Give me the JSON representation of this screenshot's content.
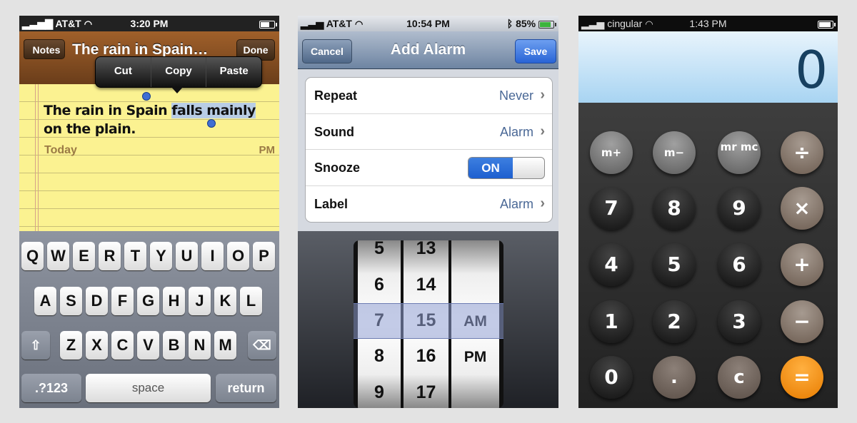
{
  "notes": {
    "status": {
      "carrier": "AT&T",
      "time": "3:20 PM"
    },
    "back_label": "Notes",
    "title": "The rain in Spain…",
    "done_label": "Done",
    "today_label": "Today",
    "time_fragment": "PM",
    "edit_menu": [
      "Cut",
      "Copy",
      "Paste"
    ],
    "text_before": "The rain in Spain ",
    "text_selected": "falls mainly",
    "text_after": " on the plain.",
    "keyboard": {
      "row1": [
        "Q",
        "W",
        "E",
        "R",
        "T",
        "Y",
        "U",
        "I",
        "O",
        "P"
      ],
      "row2": [
        "A",
        "S",
        "D",
        "F",
        "G",
        "H",
        "J",
        "K",
        "L"
      ],
      "row3": [
        "Z",
        "X",
        "C",
        "V",
        "B",
        "N",
        "M"
      ],
      "shift_glyph": "⇧",
      "delete_glyph": "⌫",
      "numbers_label": ".?123",
      "space_label": "space",
      "return_label": "return"
    }
  },
  "alarm": {
    "status": {
      "carrier": "AT&T",
      "time": "10:54 PM",
      "battery": "85%",
      "battery_level": 0.85
    },
    "cancel_label": "Cancel",
    "title": "Add Alarm",
    "save_label": "Save",
    "rows": [
      {
        "label": "Repeat",
        "value": "Never"
      },
      {
        "label": "Sound",
        "value": "Alarm"
      },
      {
        "label": "Snooze",
        "toggle": "ON"
      },
      {
        "label": "Label",
        "value": "Alarm"
      }
    ],
    "picker": {
      "hours": [
        "5",
        "6",
        "7",
        "8",
        "9"
      ],
      "minutes": [
        "13",
        "14",
        "15",
        "16",
        "17"
      ],
      "ampm": [
        "AM",
        "PM"
      ]
    }
  },
  "calculator": {
    "status": {
      "carrier": "cingular",
      "time": "1:43 PM"
    },
    "display": "0",
    "buttons": {
      "m_plus": "m+",
      "m_minus": "m−",
      "mr_mc": "mr mc",
      "divide": "÷",
      "seven": "7",
      "eight": "8",
      "nine": "9",
      "multiply": "×",
      "four": "4",
      "five": "5",
      "six": "6",
      "plus": "+",
      "one": "1",
      "two": "2",
      "three": "3",
      "minus": "−",
      "zero": "0",
      "dot": ".",
      "clear": "c",
      "equals": "="
    }
  },
  "colors": {
    "background": "#e3e3e3",
    "notes_paper": "#fbf291",
    "alarm_accent": "#2964d6",
    "calc_equals": "#e87c00"
  }
}
